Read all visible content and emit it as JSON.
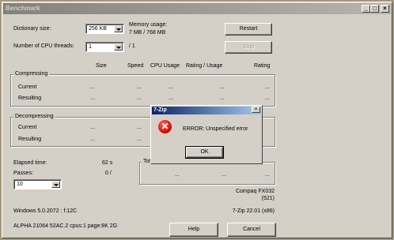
{
  "window": {
    "title": "Benchmark",
    "controls": [
      "_",
      "□",
      "×"
    ]
  },
  "settings": {
    "dict_label": "Dictionary size:",
    "dict_value": "256 KB",
    "threads_label": "Number of CPU threads:",
    "threads_value": "1",
    "threads_total": "/ 1",
    "memory_label": "Memory usage:",
    "memory_value": "7 MB / 768 MB"
  },
  "buttons": {
    "restart": "Restart",
    "stop": "Stop",
    "help": "Help",
    "cancel": "Cancel"
  },
  "columns": [
    "Size",
    "Speed",
    "CPU Usage",
    "Rating / Usage",
    "Rating"
  ],
  "compressing": {
    "label": "Compressing",
    "rows": [
      {
        "label": "Current",
        "values": [
          "...",
          "...",
          "...",
          "...",
          "..."
        ]
      },
      {
        "label": "Resulting",
        "values": [
          "...",
          "...",
          "...",
          "...",
          "..."
        ]
      }
    ]
  },
  "decompressing": {
    "label": "Decompressing",
    "rows": [
      {
        "label": "Current",
        "values": [
          "...",
          "..."
        ]
      },
      {
        "label": "Resulting",
        "values": [
          "...",
          "..."
        ]
      }
    ]
  },
  "stats": {
    "elapsed_label": "Elapsed time:",
    "elapsed_value": "62 s",
    "passes_label": "Passes:",
    "passes_value": "0 /",
    "passes_select": "10",
    "total_label": "Tota",
    "total_values": [
      "...",
      "...",
      "..."
    ]
  },
  "info": {
    "computer": "Compaq FX032",
    "computer_code": "(521)",
    "os": "Windows 5.0.2072 : f:12C",
    "version": "7-Zip 22.01 (x86)",
    "cpu": "ALPHA 21064 52AC.2 cpus:1 page:8K 2G"
  },
  "dialog": {
    "title": "7-Zip",
    "close": "×",
    "message": "ERROR: Unspecified error",
    "ok": "OK",
    "icon": "error-icon",
    "icon_glyph": "✕",
    "icon_color": "#d40000"
  }
}
